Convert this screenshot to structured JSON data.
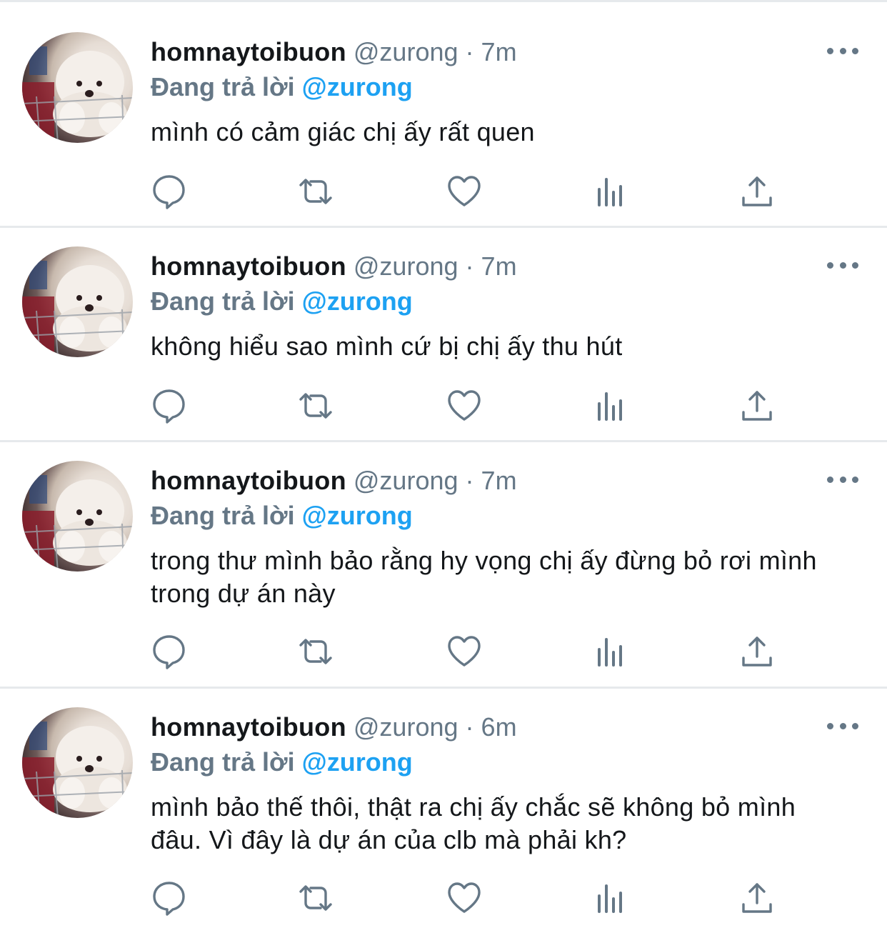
{
  "tweets": [
    {
      "name": "homnaytoibuon",
      "handle": "@zurong",
      "separator": "·",
      "time": "7m",
      "reply_label": "Đang trả lời",
      "reply_handle": "@zurong",
      "text": "mình có cảm giác chị ấy rất quen"
    },
    {
      "name": "homnaytoibuon",
      "handle": "@zurong",
      "separator": "·",
      "time": "7m",
      "reply_label": "Đang trả lời",
      "reply_handle": "@zurong",
      "text": "không hiểu sao mình cứ bị chị ấy thu hút"
    },
    {
      "name": "homnaytoibuon",
      "handle": "@zurong",
      "separator": "·",
      "time": "7m",
      "reply_label": "Đang trả lời",
      "reply_handle": "@zurong",
      "text": "trong thư mình bảo rằng hy vọng chị ấy đừng bỏ rơi mình trong dự án này"
    },
    {
      "name": "homnaytoibuon",
      "handle": "@zurong",
      "separator": "·",
      "time": "6m",
      "reply_label": "Đang trả lời",
      "reply_handle": "@zurong",
      "text": "mình bảo thế thôi, thật ra chị ấy chắc sẽ không bỏ mình đâu. Vì đây là dự án của clb mà phải kh?"
    }
  ],
  "icons": {
    "avatar": "samoyed-puppy-avatar",
    "more": "more-options-icon",
    "actions": [
      "reply-icon",
      "retweet-icon",
      "like-icon",
      "analytics-icon",
      "share-icon"
    ]
  },
  "colors": {
    "text": "#14171a",
    "secondary": "#657786",
    "accent": "#1da1f2",
    "divider": "#e6e9ec"
  }
}
